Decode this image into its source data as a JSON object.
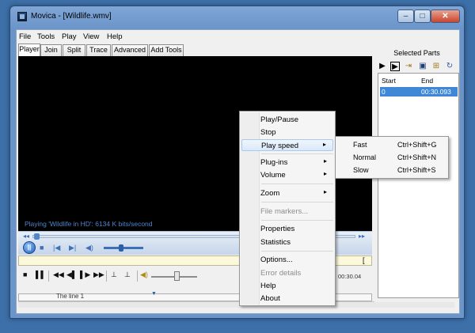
{
  "window": {
    "title": "Movica - [Wildlife.wmv]"
  },
  "titlebar_buttons": {
    "minimize": "–",
    "maximize": "□",
    "close": "✕"
  },
  "menubar": [
    "File",
    "Tools",
    "Play",
    "View",
    "Help"
  ],
  "tabs": [
    "Player",
    "Join",
    "Split",
    "Trace",
    "Advanced",
    "Add Tools"
  ],
  "active_tab": "Player",
  "video": {
    "status": "Playing 'Wildlife in HD': 6134 K bits/second"
  },
  "seek": {
    "left_icon": "◂◂",
    "right_icon": "▸▸"
  },
  "player_controls": {
    "pause_icon": "||",
    "stop_icon": "■",
    "prev_icon": "|◀",
    "next_icon": "▶|",
    "volume_icon": "◀)"
  },
  "info_bar": {
    "right_mark": "["
  },
  "transport": {
    "stop": "■",
    "pause": "▌▌",
    "rewind": "◀◀",
    "frame_back": "◀▌",
    "frame_fwd": "▌▶",
    "forward": "▶▶",
    "mark_in": "⊥",
    "mark_out": "⊥",
    "volume": "◀)"
  },
  "time_display": "00:30.04",
  "timeline": {
    "label": "The line 1",
    "marker": "▼"
  },
  "selected_parts": {
    "title": "Selected Parts",
    "toolbar_icons": [
      "play-icon",
      "play-from-icon",
      "export-icon",
      "save-icon",
      "open-icon",
      "refresh-icon"
    ],
    "toolbar_glyphs": [
      "▶",
      "▶",
      "⇥",
      "▣",
      "⊞",
      "↻"
    ],
    "columns": [
      "Start",
      "End"
    ],
    "rows": [
      {
        "start": "0",
        "end": "00:30.093"
      }
    ]
  },
  "context_menu": {
    "items": [
      {
        "label": "Play/Pause",
        "disabled": false,
        "submenu": false
      },
      {
        "label": "Stop",
        "disabled": false,
        "submenu": false
      },
      {
        "label": "Play speed",
        "disabled": false,
        "submenu": true,
        "highlighted": true
      },
      {
        "label": "Plug-ins",
        "disabled": false,
        "submenu": true
      },
      {
        "label": "Volume",
        "disabled": false,
        "submenu": true
      },
      {
        "label": "Zoom",
        "disabled": false,
        "submenu": true
      },
      {
        "label": "File markers...",
        "disabled": true,
        "submenu": false
      },
      {
        "label": "Properties",
        "disabled": false,
        "submenu": false
      },
      {
        "label": "Statistics",
        "disabled": false,
        "submenu": false
      },
      {
        "label": "Options...",
        "disabled": false,
        "submenu": false
      },
      {
        "label": "Error details",
        "disabled": true,
        "submenu": false
      },
      {
        "label": "Help",
        "disabled": false,
        "submenu": false
      },
      {
        "label": "About",
        "disabled": false,
        "submenu": false
      }
    ],
    "arrow": "▸"
  },
  "speed_submenu": {
    "items": [
      {
        "label": "Fast",
        "shortcut": "Ctrl+Shift+G"
      },
      {
        "label": "Normal",
        "shortcut": "Ctrl+Shift+N"
      },
      {
        "label": "Slow",
        "shortcut": "Ctrl+Shift+S"
      }
    ]
  }
}
